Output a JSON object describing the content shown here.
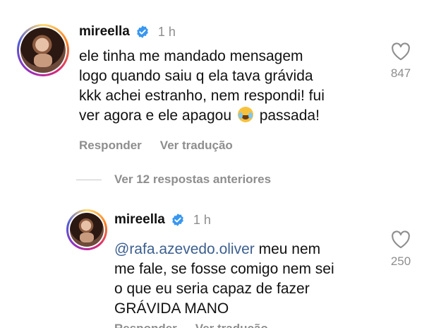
{
  "comment1": {
    "username": "mireella",
    "time": "1 h",
    "text_lines": [
      "ele tinha me mandado mensagem",
      "logo quando saiu q ela tava grávida",
      "kkk achei estranho, nem respondi! fui",
      "ver agora e ele apagou",
      "passada!"
    ],
    "emoji_icon": "face-with-tears-of-joy-icon",
    "like_count": "847",
    "reply_label": "Responder",
    "translate_label": "Ver tradução"
  },
  "view_replies_label": "Ver 12 respostas anteriores",
  "comment2": {
    "username": "mireella",
    "time": "1 h",
    "mention": "@rafa.azevedo.oliver",
    "text_lines": [
      "meu nem",
      "me fale, se fosse comigo nem sei",
      "o que eu seria capaz de fazer",
      "GRÁVIDA MANO"
    ],
    "like_count": "250",
    "reply_label": "Responder",
    "translate_label": "Ver tradução"
  },
  "colors": {
    "verified_badge": "#3897f0",
    "mention": "#3b5f8f",
    "secondary_text": "#8e8e8e"
  }
}
